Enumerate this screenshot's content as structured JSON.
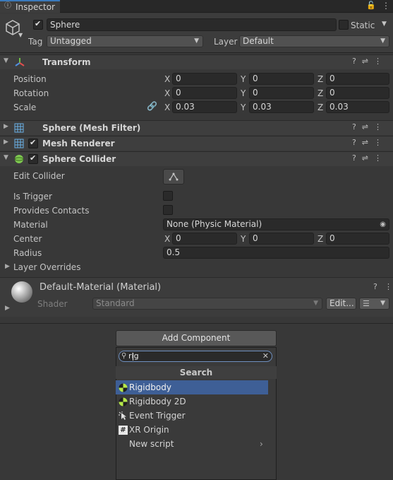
{
  "tab": {
    "label": "Inspector"
  },
  "object": {
    "name": "Sphere",
    "static_label": "Static",
    "tag_label": "Tag",
    "tag_value": "Untagged",
    "layer_label": "Layer",
    "layer_value": "Default"
  },
  "transform": {
    "title": "Transform",
    "position_label": "Position",
    "rotation_label": "Rotation",
    "scale_label": "Scale",
    "position": {
      "x": "0",
      "y": "0",
      "z": "0"
    },
    "rotation": {
      "x": "0",
      "y": "0",
      "z": "0"
    },
    "scale": {
      "x": "0.03",
      "y": "0.03",
      "z": "0.03"
    },
    "axes": {
      "x": "X",
      "y": "Y",
      "z": "Z"
    }
  },
  "mesh_filter": {
    "title": "Sphere (Mesh Filter)"
  },
  "mesh_renderer": {
    "title": "Mesh Renderer"
  },
  "collider": {
    "title": "Sphere Collider",
    "edit_label": "Edit Collider",
    "trigger_label": "Is Trigger",
    "contacts_label": "Provides Contacts",
    "material_label": "Material",
    "material_value": "None (Physic Material)",
    "center_label": "Center",
    "center": {
      "x": "0",
      "y": "0",
      "z": "0"
    },
    "radius_label": "Radius",
    "radius_value": "0.5",
    "overrides_label": "Layer Overrides"
  },
  "material": {
    "title": "Default-Material (Material)",
    "shader_label": "Shader",
    "shader_value": "Standard",
    "edit_label": "Edit..."
  },
  "add_component": {
    "button_label": "Add Component",
    "search_value": "rig",
    "results_header": "Search",
    "results": [
      {
        "label": "Rigidbody",
        "icon": "rigidbody-icon",
        "selected": true
      },
      {
        "label": "Rigidbody 2D",
        "icon": "rigidbody2d-icon",
        "selected": false
      },
      {
        "label": "Event Trigger",
        "icon": "event-trigger-icon",
        "selected": false
      },
      {
        "label": "XR Origin",
        "icon": "script-icon",
        "selected": false
      },
      {
        "label": "New script",
        "icon": "",
        "selected": false
      }
    ]
  },
  "colors": {
    "accent": "#3a79bb",
    "selection": "#3e5f96",
    "background": "#383838"
  }
}
